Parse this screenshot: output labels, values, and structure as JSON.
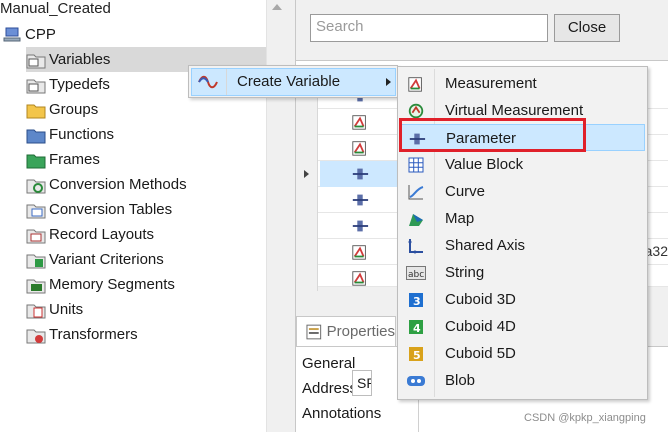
{
  "tree": {
    "root_title": "Manual_Created",
    "project": "CPP",
    "items": [
      {
        "label": "Variables",
        "icon": "variables-folder-icon"
      },
      {
        "label": "Typedefs",
        "icon": "typedefs-folder-icon"
      },
      {
        "label": "Groups",
        "icon": "groups-folder-icon"
      },
      {
        "label": "Functions",
        "icon": "functions-folder-icon"
      },
      {
        "label": "Frames",
        "icon": "frames-folder-icon"
      },
      {
        "label": "Conversion Methods",
        "icon": "conversion-methods-icon"
      },
      {
        "label": "Conversion Tables",
        "icon": "conversion-tables-icon"
      },
      {
        "label": "Record Layouts",
        "icon": "record-layouts-icon"
      },
      {
        "label": "Variant Criterions",
        "icon": "variant-criterions-icon"
      },
      {
        "label": "Memory Segments",
        "icon": "memory-segments-icon"
      },
      {
        "label": "Units",
        "icon": "units-icon"
      },
      {
        "label": "Transformers",
        "icon": "transformers-icon"
      }
    ]
  },
  "search": {
    "placeholder": "Search"
  },
  "close_label": "Close",
  "grid": {
    "rows": [
      {
        "icon": "parameter-icon",
        "tail": ""
      },
      {
        "icon": "measurement-icon",
        "tail": ""
      },
      {
        "icon": "measurement-icon",
        "tail": ""
      },
      {
        "icon": "parameter-icon",
        "tail": ""
      },
      {
        "icon": "parameter-icon",
        "tail": ""
      },
      {
        "icon": "parameter-icon",
        "tail": ""
      },
      {
        "icon": "measurement-icon",
        "tail": "a32"
      },
      {
        "icon": "measurement-icon",
        "tail": ""
      }
    ]
  },
  "properties": {
    "tab_label": "Properties",
    "items": [
      "General",
      "Address",
      "Annotations"
    ],
    "value_fragment": "SP"
  },
  "context_menu": {
    "create_variable": "Create Variable"
  },
  "submenu": {
    "items": [
      {
        "label": "Measurement",
        "icon": "measurement-icon"
      },
      {
        "label": "Virtual Measurement",
        "icon": "virtual-measurement-icon"
      },
      {
        "label": "Parameter",
        "icon": "parameter-icon"
      },
      {
        "label": "Value Block",
        "icon": "value-block-icon"
      },
      {
        "label": "Curve",
        "icon": "curve-icon"
      },
      {
        "label": "Map",
        "icon": "map-icon"
      },
      {
        "label": "Shared Axis",
        "icon": "shared-axis-icon"
      },
      {
        "label": "String",
        "icon": "string-icon"
      },
      {
        "label": "Cuboid 3D",
        "icon": "cuboid-3d-icon"
      },
      {
        "label": "Cuboid 4D",
        "icon": "cuboid-4d-icon"
      },
      {
        "label": "Cuboid 5D",
        "icon": "cuboid-5d-icon"
      },
      {
        "label": "Blob",
        "icon": "blob-icon"
      }
    ]
  },
  "watermark": "CSDN @kpkp_xiangping"
}
